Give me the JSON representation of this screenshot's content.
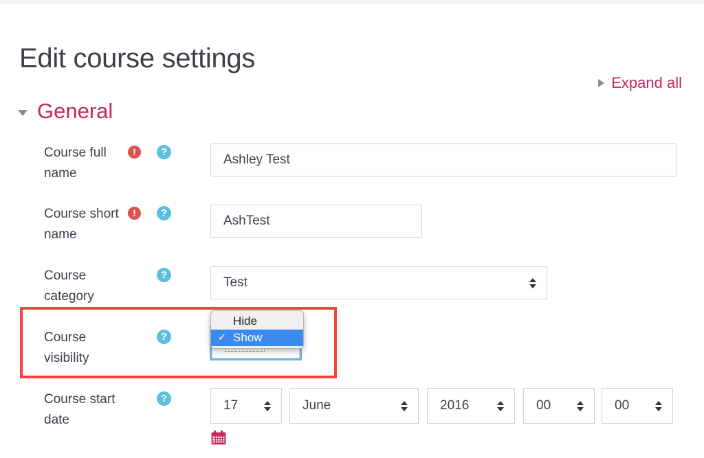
{
  "page": {
    "title": "Edit course settings"
  },
  "expand": {
    "label": "Expand all",
    "icon": "caret-right-icon"
  },
  "section": {
    "title": "General",
    "icon": "caret-down-icon"
  },
  "icons": {
    "required": "!",
    "help": "?",
    "calendar": "calendar-icon"
  },
  "colors": {
    "accent": "#c4275c",
    "required": "#d9534f",
    "help": "#5bc0de",
    "highlight": "#f9423a",
    "menu_selected": "#3b8bee"
  },
  "fields": {
    "course_full_name": {
      "label": "Course full name",
      "value": "Ashley Test",
      "placeholder": "",
      "required": true,
      "has_help": true
    },
    "course_short_name": {
      "label": "Course short name",
      "value": "AshTest",
      "placeholder": "",
      "required": true,
      "has_help": true
    },
    "course_category": {
      "label": "Course category",
      "value": "Test",
      "required": false,
      "has_help": true
    },
    "course_visibility": {
      "label": "Course visibility",
      "value": "Show",
      "required": false,
      "has_help": true,
      "open": true,
      "options": [
        {
          "label": "Hide",
          "selected": false,
          "check": ""
        },
        {
          "label": "Show",
          "selected": true,
          "check": "✓"
        }
      ]
    },
    "course_start_date": {
      "label": "Course start date",
      "required": false,
      "has_help": true,
      "day": "17",
      "month": "June",
      "year": "2016",
      "hour": "00",
      "minute": "00"
    }
  }
}
